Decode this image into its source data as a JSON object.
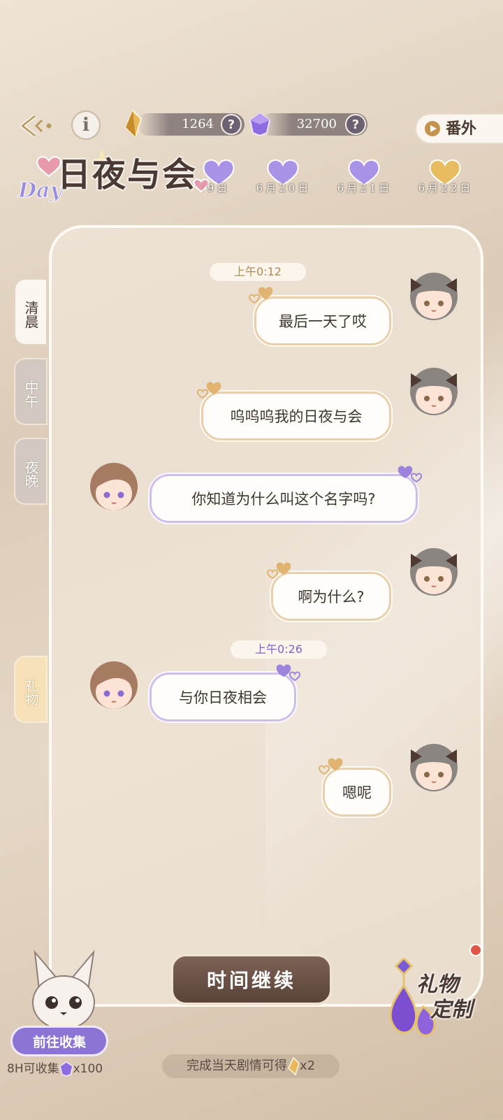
{
  "currency": {
    "gold_amount": "1264",
    "gem_amount": "32700",
    "help_symbol": "?"
  },
  "header": {
    "title": "日夜与会",
    "title_accent": "Day",
    "extra_button": "番外"
  },
  "dates": [
    "6月19日",
    "6月20日",
    "6月21日",
    "6月22日"
  ],
  "side_tabs": {
    "morning": "清晨",
    "noon": "中午",
    "night": "夜晚",
    "gift": "礼物"
  },
  "chat": {
    "timestamps": [
      "上午0:12",
      "上午0:26"
    ],
    "messages": [
      {
        "sender": "me",
        "text": "最后一天了哎"
      },
      {
        "sender": "me",
        "text": "呜呜呜我的日夜与会"
      },
      {
        "sender": "him",
        "text": "你知道为什么叫这个名字吗?"
      },
      {
        "sender": "me",
        "text": "啊为什么?"
      },
      {
        "sender": "him",
        "text": "与你日夜相会"
      },
      {
        "sender": "me",
        "text": "嗯呢"
      }
    ]
  },
  "footer": {
    "continue_button": "时间继续",
    "collect_button": "前往收集",
    "collect_reward_prefix": "8H可收集",
    "collect_reward_suffix": "x100",
    "completion_note_prefix": "完成当天剧情可得",
    "completion_note_suffix": "x2",
    "gift_custom_line1": "礼物",
    "gift_custom_line2": "定制"
  },
  "colors": {
    "accent_brown": "#5a4338",
    "bubble_me_border": "#e8cfae",
    "bubble_him_border": "#cdbfe9",
    "timestamp_me": "#b08a56",
    "timestamp_him": "#7b65c8",
    "gem_purple": "#7b5cd6",
    "gold": "#d9a64a"
  }
}
